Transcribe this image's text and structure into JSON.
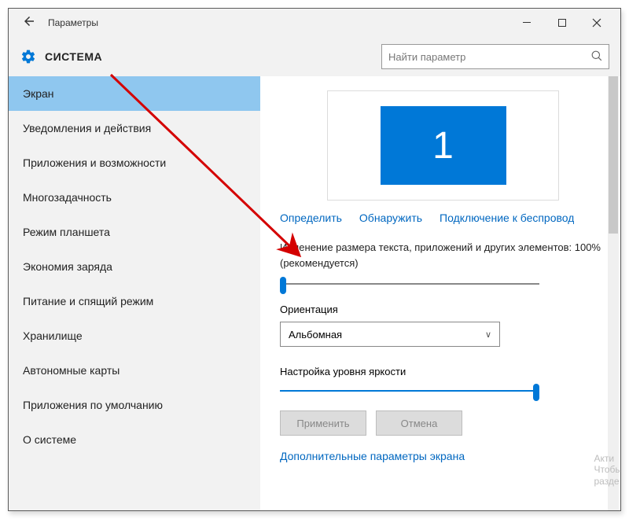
{
  "window": {
    "title": "Параметры"
  },
  "header": {
    "section": "СИСТЕМА",
    "search_placeholder": "Найти параметр"
  },
  "sidebar": {
    "items": [
      {
        "label": "Экран",
        "active": true
      },
      {
        "label": "Уведомления и действия",
        "active": false
      },
      {
        "label": "Приложения и возможности",
        "active": false
      },
      {
        "label": "Многозадачность",
        "active": false
      },
      {
        "label": "Режим планшета",
        "active": false
      },
      {
        "label": "Экономия заряда",
        "active": false
      },
      {
        "label": "Питание и спящий режим",
        "active": false
      },
      {
        "label": "Хранилище",
        "active": false
      },
      {
        "label": "Автономные карты",
        "active": false
      },
      {
        "label": "Приложения по умолчанию",
        "active": false
      },
      {
        "label": "О системе",
        "active": false
      }
    ]
  },
  "display": {
    "monitor_number": "1",
    "links": {
      "identify": "Определить",
      "detect": "Обнаружить",
      "wireless": "Подключение к беспровод"
    },
    "scale_label": "Изменение размера текста, приложений и других элементов: 100% (рекомендуется)",
    "orientation_label": "Ориентация",
    "orientation_value": "Альбомная",
    "brightness_label": "Настройка уровня яркости",
    "apply_btn": "Применить",
    "cancel_btn": "Отмена",
    "advanced_link": "Дополнительные параметры экрана"
  },
  "watermark": {
    "line1": "Акти",
    "line2": "Чтобы",
    "line3": "разде"
  }
}
